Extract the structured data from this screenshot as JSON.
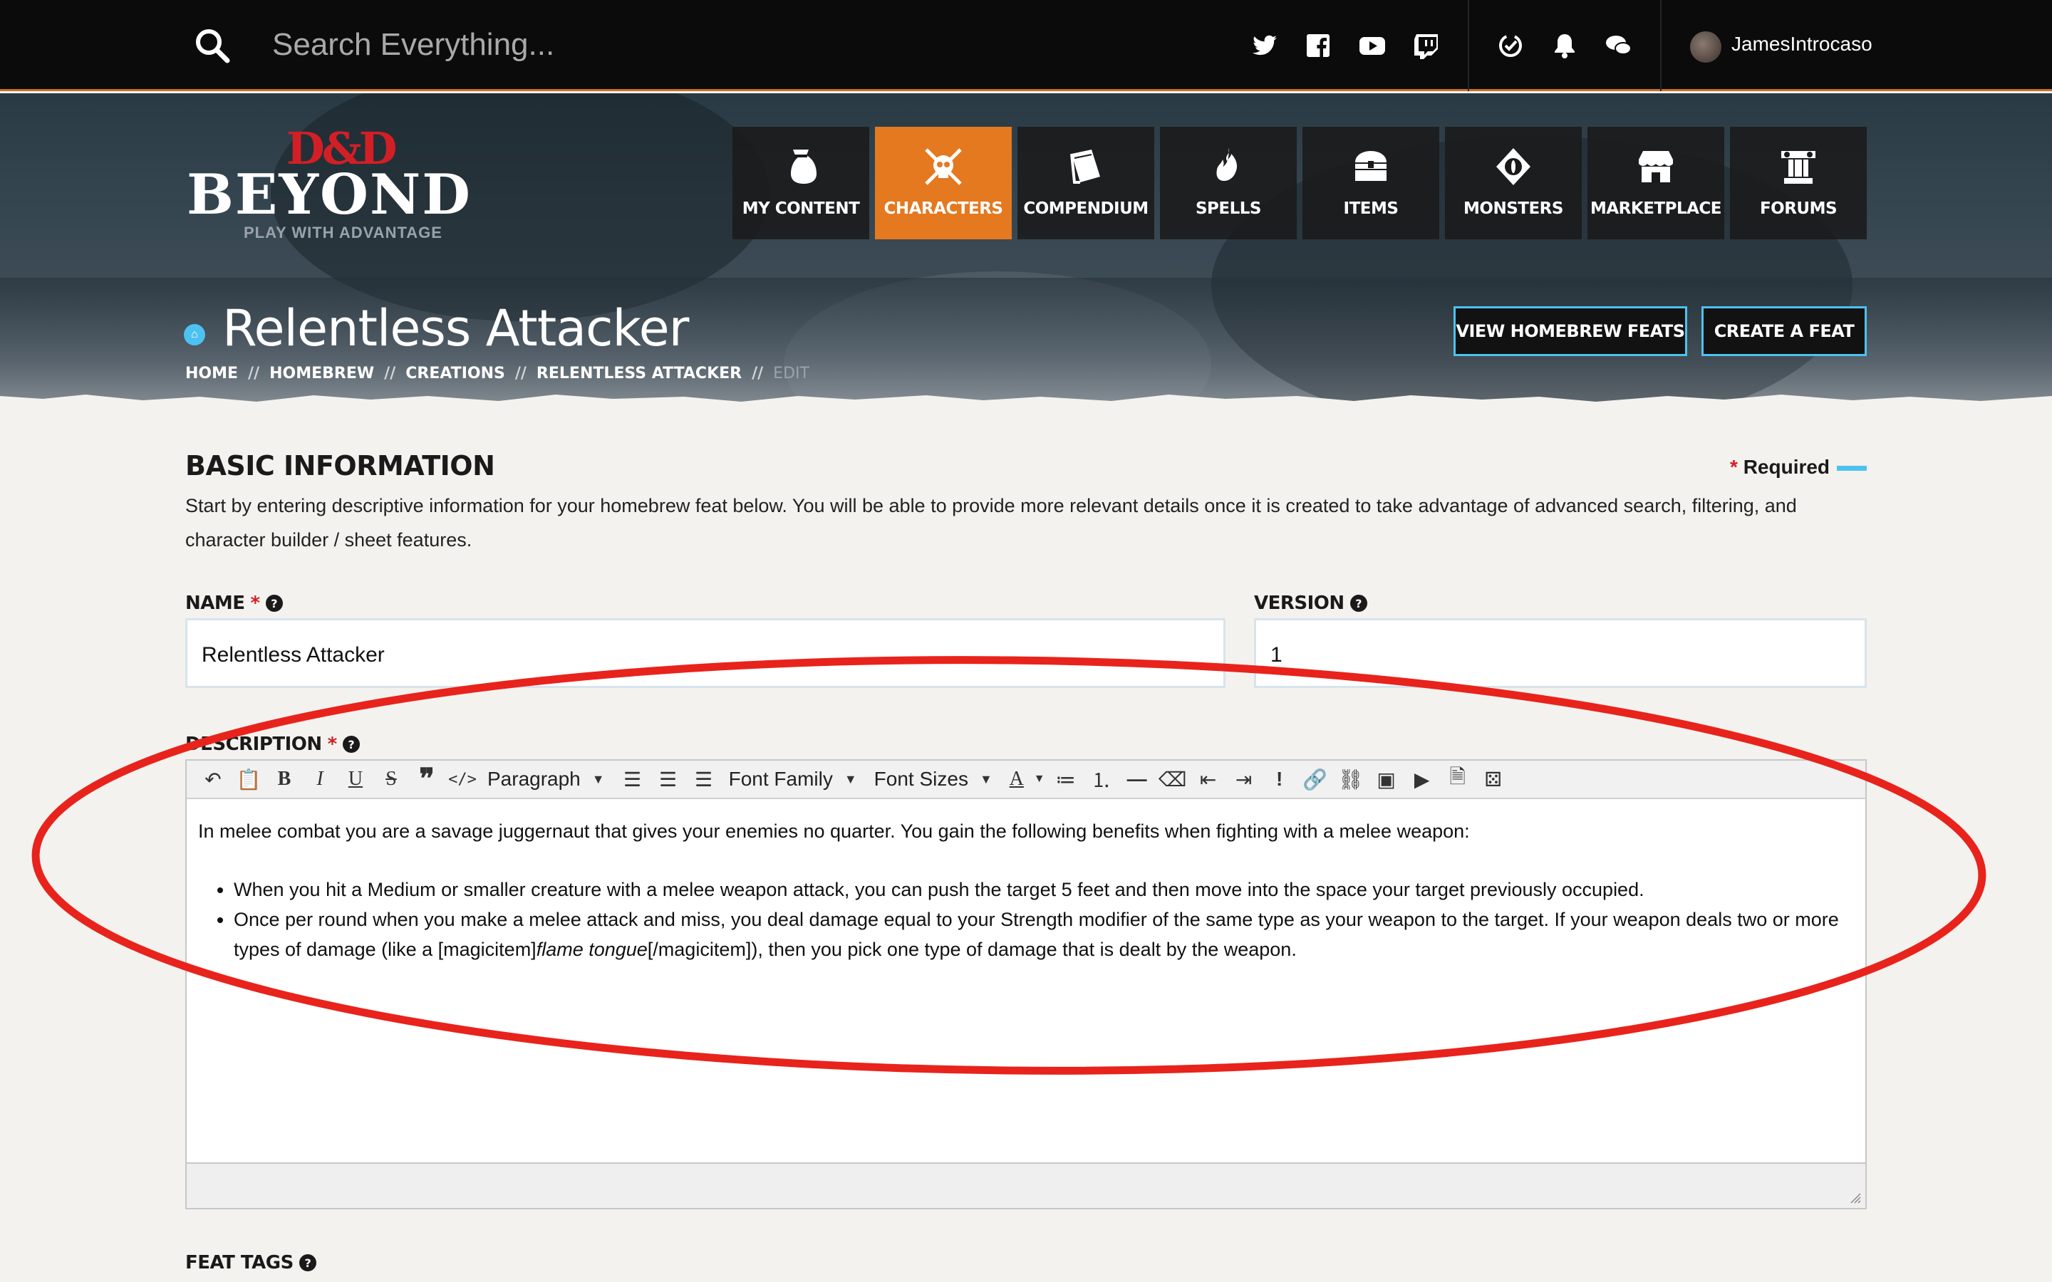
{
  "topbar": {
    "search_placeholder": "Search Everything...",
    "username": "JamesIntrocaso",
    "social_icons": [
      "twitter-icon",
      "facebook-icon",
      "youtube-icon",
      "twitch-icon"
    ],
    "utility_icons": [
      "subscription-icon",
      "bell-icon",
      "chat-icon"
    ]
  },
  "logo": {
    "mark": "D&D",
    "name": "BEYOND",
    "tagline": "PLAY WITH ADVANTAGE"
  },
  "nav": [
    {
      "label": "MY CONTENT",
      "icon": "bag-icon",
      "active": false
    },
    {
      "label": "CHARACTERS",
      "icon": "skull-crossed-swords-icon",
      "active": true
    },
    {
      "label": "COMPENDIUM",
      "icon": "book-icon",
      "active": false
    },
    {
      "label": "SPELLS",
      "icon": "flame-hand-icon",
      "active": false
    },
    {
      "label": "ITEMS",
      "icon": "chest-icon",
      "active": false
    },
    {
      "label": "MONSTERS",
      "icon": "monster-eye-icon",
      "active": false
    },
    {
      "label": "MARKETPLACE",
      "icon": "store-icon",
      "active": false
    },
    {
      "label": "FORUMS",
      "icon": "pillar-icon",
      "active": false
    }
  ],
  "header": {
    "title": "Relentless Attacker",
    "breadcrumb": [
      "HOME",
      "HOMEBREW",
      "CREATIONS",
      "RELENTLESS ATTACKER"
    ],
    "breadcrumb_current": "EDIT",
    "breadcrumb_separator": "//",
    "buttons": {
      "view": "VIEW HOMEBREW FEATS",
      "create": "CREATE A FEAT"
    }
  },
  "section": {
    "title": "BASIC INFORMATION",
    "required_label": "Required",
    "required_star": "*",
    "intro": "Start by entering descriptive information for your homebrew feat below. You will be able to provide more relevant details once it is created to take advantage of advanced search, filtering, and character builder / sheet features."
  },
  "fields": {
    "name_label": "NAME",
    "name_value": "Relentless Attacker",
    "version_label": "VERSION",
    "version_value": "1",
    "description_label": "DESCRIPTION",
    "feat_tags_label": "FEAT TAGS",
    "help_glyph": "?"
  },
  "toolbar": {
    "paragraph": "Paragraph",
    "font_family": "Font Family",
    "font_sizes": "Font Sizes"
  },
  "description": {
    "intro": "In melee combat you are a savage juggernaut that gives your enemies no quarter. You gain the following benefits when fighting with a melee weapon:",
    "bullet1": "When you hit a Medium or smaller creature with a melee weapon attack, you can push the target 5 feet and then move into the space your target previously occupied.",
    "bullet2_pre": "Once per round when you make a melee attack and miss, you deal damage equal to your Strength modifier of the same type as your weapon to the target. If your weapon deals two or more types of damage (like a [magicitem]",
    "bullet2_italic": "flame tongue",
    "bullet2_post": "[/magicitem]), then you pick one type of damage that is dealt by the weapon."
  },
  "colors": {
    "accent_orange": "#e4791f",
    "accent_blue": "#4dc2f0",
    "required_red": "#d21f25",
    "annotation_red": "#e8231c"
  }
}
